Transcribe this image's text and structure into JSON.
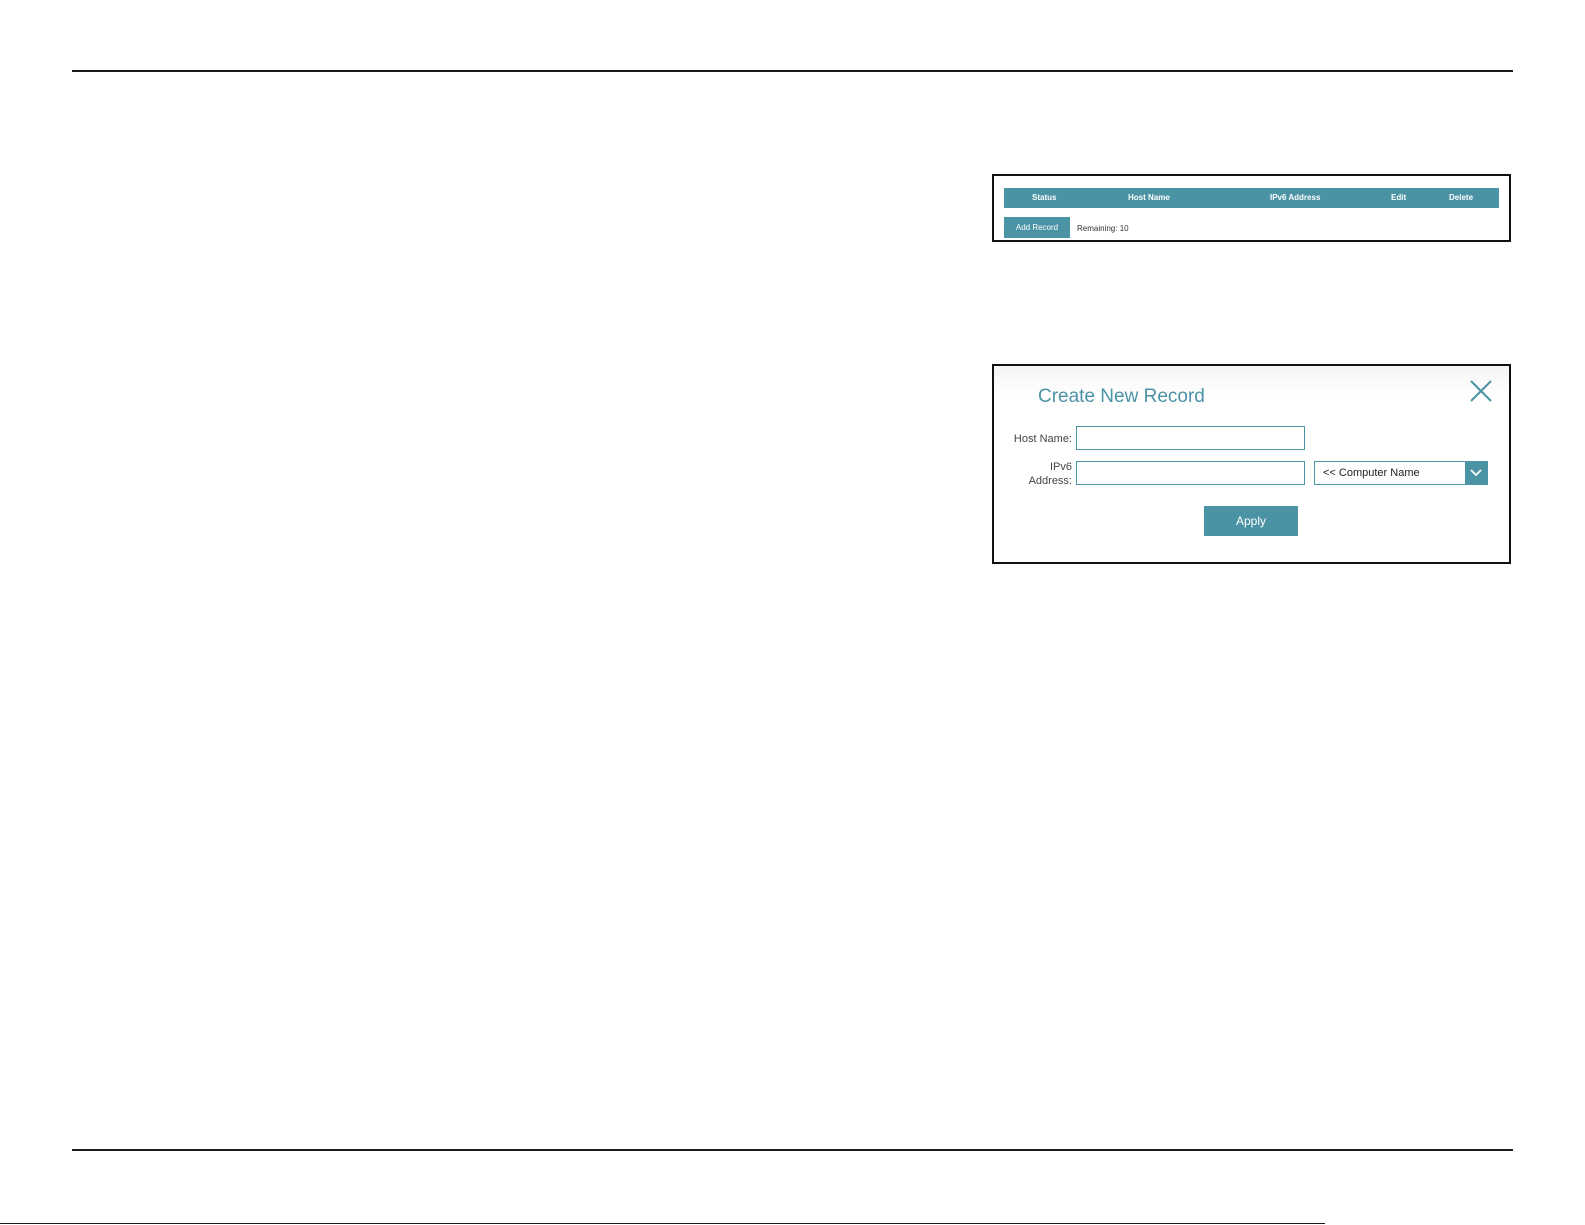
{
  "record_table": {
    "columns": [
      "Status",
      "Host Name",
      "IPv6 Address",
      "Edit",
      "Delete"
    ],
    "add_record_label": "Add Record",
    "remaining_text": "Remaining: 10"
  },
  "dialog": {
    "title": "Create New Record",
    "host_name_label": "Host Name:",
    "host_name_value": "",
    "ipv6_label_line1": "IPv6",
    "ipv6_label_line2": "Address:",
    "ipv6_value": "",
    "computer_select_value": "<< Computer Name",
    "apply_label": "Apply"
  },
  "colors": {
    "accent": "#4a93a4"
  },
  "icons": {
    "close": "close-icon",
    "dropdown": "chevron-down-icon"
  }
}
